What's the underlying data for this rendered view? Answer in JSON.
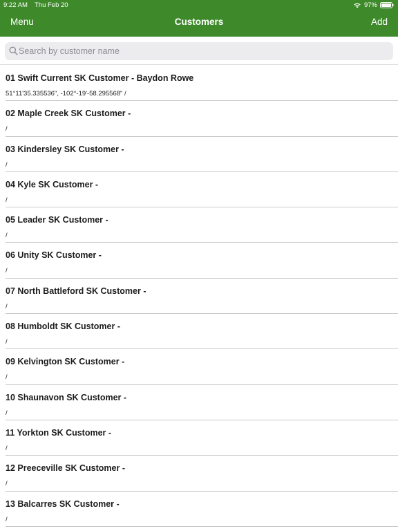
{
  "status_bar": {
    "time": "9:22 AM",
    "date": "Thu Feb 20",
    "battery": "97%",
    "icons": [
      "wifi-icon",
      "battery-icon"
    ]
  },
  "nav": {
    "menu_label": "Menu",
    "title": "Customers",
    "add_label": "Add"
  },
  "search": {
    "placeholder": "Search by customer name",
    "value": "",
    "icon": "search-icon"
  },
  "colors": {
    "header": "#3e8a2b",
    "header_text": "#ffffff",
    "search_bg": "#ececef",
    "separator": "#c8c8cc"
  },
  "customers": [
    {
      "name": "01 Swift Current SK Customer - Baydon Rowe",
      "detail": "51°11'35.335536\", -102°-19'-58.295568\" /"
    },
    {
      "name": "02 Maple Creek SK Customer -",
      "detail": "/"
    },
    {
      "name": "03 Kindersley SK Customer -",
      "detail": "/"
    },
    {
      "name": "04 Kyle SK Customer -",
      "detail": "/"
    },
    {
      "name": "05 Leader SK Customer -",
      "detail": "/"
    },
    {
      "name": "06 Unity SK Customer -",
      "detail": "/"
    },
    {
      "name": "07 North Battleford SK Customer -",
      "detail": "/"
    },
    {
      "name": "08 Humboldt SK Customer -",
      "detail": "/"
    },
    {
      "name": "09 Kelvington SK Customer -",
      "detail": "/"
    },
    {
      "name": "10 Shaunavon SK Customer -",
      "detail": "/"
    },
    {
      "name": "11 Yorkton SK Customer -",
      "detail": "/"
    },
    {
      "name": "12 Preeceville SK Customer -",
      "detail": "/"
    },
    {
      "name": "13 Balcarres SK Customer -",
      "detail": "/"
    }
  ]
}
